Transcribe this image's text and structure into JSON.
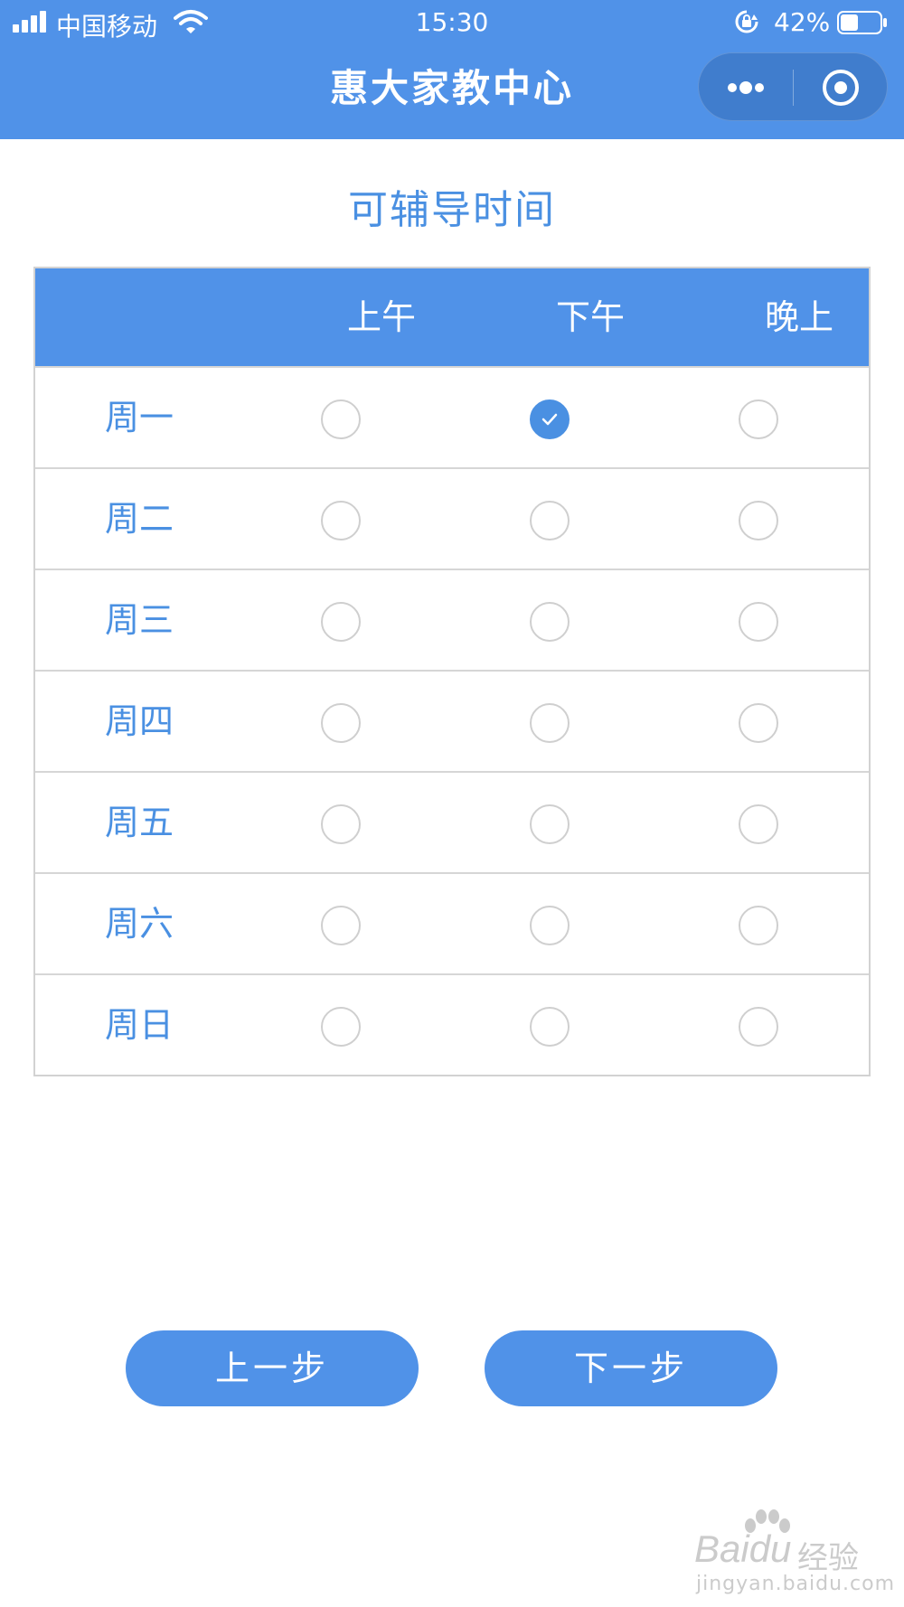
{
  "status_bar": {
    "carrier": "中国移动",
    "time": "15:30",
    "battery": "42%"
  },
  "nav": {
    "title": "惠大家教中心"
  },
  "page": {
    "title": "可辅导时间"
  },
  "schedule": {
    "columns": [
      "上午",
      "下午",
      "晚上"
    ],
    "rows": [
      {
        "day": "周一",
        "selected": [
          false,
          true,
          false
        ]
      },
      {
        "day": "周二",
        "selected": [
          false,
          false,
          false
        ]
      },
      {
        "day": "周三",
        "selected": [
          false,
          false,
          false
        ]
      },
      {
        "day": "周四",
        "selected": [
          false,
          false,
          false
        ]
      },
      {
        "day": "周五",
        "selected": [
          false,
          false,
          false
        ]
      },
      {
        "day": "周六",
        "selected": [
          false,
          false,
          false
        ]
      },
      {
        "day": "周日",
        "selected": [
          false,
          false,
          false
        ]
      }
    ]
  },
  "buttons": {
    "prev": "上一步",
    "next": "下一步"
  },
  "watermark": {
    "logo": "Baidu",
    "name": "经验",
    "url": "jingyan.baidu.com"
  },
  "colors": {
    "accent": "#5092e8",
    "text_accent": "#4a90e2",
    "border": "#d6d6d6"
  }
}
